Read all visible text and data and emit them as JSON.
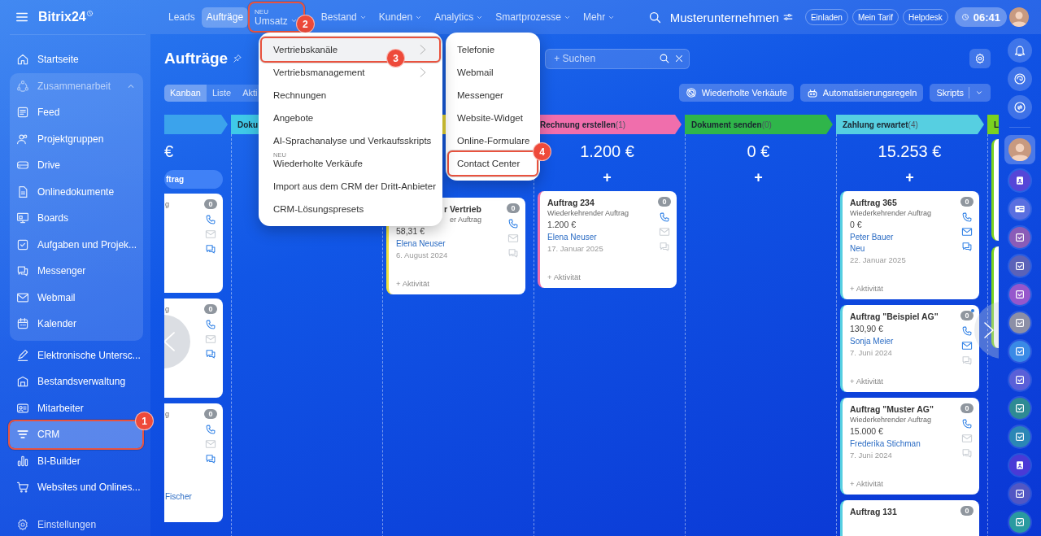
{
  "logo": "Bitrix24",
  "nav": [
    {
      "label": "Leads",
      "selected": false,
      "dropdown": false
    },
    {
      "label": "Aufträge",
      "selected": true,
      "dropdown": false
    },
    {
      "label": "Umsatz",
      "selected": false,
      "dropdown": true,
      "tag": "NEU",
      "callout": {
        "number": "2"
      }
    },
    {
      "label": "Bestand",
      "selected": false,
      "dropdown": true
    },
    {
      "label": "Kunden",
      "selected": false,
      "dropdown": true
    },
    {
      "label": "Analytics",
      "selected": false,
      "dropdown": true
    },
    {
      "label": "Smartprozesse",
      "selected": false,
      "dropdown": true
    },
    {
      "label": "Mehr",
      "selected": false,
      "dropdown": true
    }
  ],
  "company": "Musterunternehmen",
  "header_buttons": [
    "Einladen",
    "Mein Tarif",
    "Helpdesk"
  ],
  "time": "06:41",
  "sidebar": {
    "items": [
      {
        "kind": "item",
        "label": "Startseite",
        "selected": false
      },
      {
        "kind": "group",
        "label": "Zusammenarbeit",
        "expanded": true,
        "children": [
          {
            "label": "Feed",
            "selected": false
          },
          {
            "label": "Projektgruppen",
            "selected": false
          },
          {
            "label": "Drive",
            "selected": false
          },
          {
            "label": "Onlinedokumente",
            "selected": false
          },
          {
            "label": "Boards",
            "selected": false
          },
          {
            "label": "Aufgaben und Projek...",
            "selected": false
          },
          {
            "label": "Messenger",
            "selected": false
          },
          {
            "label": "Webmail",
            "selected": false
          },
          {
            "label": "Kalender",
            "selected": false
          }
        ]
      },
      {
        "kind": "item",
        "label": "Elektronische Untersc...",
        "selected": false
      },
      {
        "kind": "item",
        "label": "Bestandsverwaltung",
        "selected": false
      },
      {
        "kind": "item",
        "label": "Mitarbeiter",
        "selected": false
      },
      {
        "kind": "item",
        "label": "CRM",
        "selected": true,
        "callout": {
          "number": "1"
        }
      },
      {
        "kind": "item",
        "label": "BI-Builder",
        "selected": false
      },
      {
        "kind": "item",
        "label": "Websites und Onlines...",
        "selected": false
      }
    ],
    "footer": "Einstellungen"
  },
  "page": {
    "title": "Aufträge",
    "search": {
      "placeholder": "+ Suchen"
    },
    "views": [
      {
        "label": "Kanban",
        "selected": true
      },
      {
        "label": "Liste",
        "selected": false
      },
      {
        "label": "Akti",
        "selected": false
      }
    ],
    "actions": [
      {
        "label": "Wiederholte Verkäufe",
        "kind": "icon"
      },
      {
        "label": "Automatisierungsregeln",
        "kind": "icon"
      },
      {
        "label": "Skripts",
        "kind": "split"
      }
    ]
  },
  "board": {
    "columns": [
      {
        "kind": "cut",
        "color": "#3ba3ec",
        "amount": "€",
        "button": "ftrag",
        "cards": [
          {
            "subtitle": "g",
            "counter": "0",
            "phone": true,
            "mail": false,
            "chat": true
          },
          {
            "subtitle": "g",
            "counter": "0",
            "phone": true,
            "mail": false,
            "chat": true
          },
          {
            "subtitle": "g",
            "person": "Fischer",
            "counter": "0",
            "phone": true,
            "mail": false,
            "chat": true
          }
        ]
      },
      {
        "kind": "full",
        "title": "Doku",
        "color": "#3fc9e8"
      },
      {
        "kind": "covered",
        "color": "#f2e23a",
        "cards": [
          {
            "title": "r Vertrieb",
            "subtitle": "er Auftrag",
            "amount": "58,31 €",
            "person": "Elena Neuser",
            "date": "6. August 2024",
            "activity": "+ Aktivität",
            "counter": "0",
            "phone": true,
            "mail": false,
            "chat": false
          }
        ]
      },
      {
        "kind": "full",
        "title": "Rechnung erstellen",
        "count": "(1)",
        "color": "#f06eac",
        "amount": "1.200 €",
        "add": "+",
        "cards": [
          {
            "title": "Auftrag 234",
            "subtitle": "Wiederkehrender Auftrag",
            "amount": "1.200 €",
            "person": "Elena Neuser",
            "date": "17. Januar 2025",
            "activity": "+ Aktivität",
            "counter": "0",
            "phone": true,
            "mail": false,
            "chat": false
          }
        ]
      },
      {
        "kind": "full",
        "title": "Dokument senden",
        "count": "(0)",
        "color": "#2fb54a",
        "amount": "0 €",
        "add": "+"
      },
      {
        "kind": "full",
        "title": "Zahlung erwartet",
        "count": "(4)",
        "color": "#56cfe1",
        "amount": "15.253 €",
        "add": "+",
        "cards": [
          {
            "title": "Auftrag 365",
            "subtitle": "Wiederkehrender Auftrag",
            "amount": "0 €",
            "person": "Peter Bauer",
            "status": "Neu",
            "date": "22. Januar 2025",
            "activity": "+ Aktivität",
            "counter": "0",
            "phone": true,
            "mail": true,
            "chat": true
          },
          {
            "title": "Auftrag \"Beispiel AG\"",
            "amount": "130,90 €",
            "person": "Sonja Meier",
            "date": "7. Juni 2024",
            "activity": "+ Aktivität",
            "counter": "0",
            "unread": true,
            "phone": true,
            "mail": true,
            "chat": false
          },
          {
            "title": "Auftrag \"Muster AG\"",
            "subtitle": "Wiederkehrender Auftrag",
            "amount": "15.000 €",
            "person": "Frederika Stichman",
            "date": "7. Juni 2024",
            "activity": "+ Aktivität",
            "counter": "0",
            "phone": true,
            "mail": false,
            "chat": false
          },
          {
            "title": "Auftrag 131",
            "counter": "0",
            "kind": "last"
          }
        ]
      },
      {
        "kind": "full",
        "title": "L",
        "color": "#7bd21f",
        "cards": [
          {
            "kind": "hidden"
          },
          {
            "kind": "hidden"
          }
        ]
      }
    ]
  },
  "menu": {
    "items": [
      {
        "label": "Vertriebskanäle",
        "selected": true,
        "submenu": true,
        "callout": {
          "number": "3"
        }
      },
      {
        "label": "Vertriebsmanagement",
        "selected": false,
        "submenu": true
      },
      {
        "label": "Rechnungen",
        "selected": false,
        "submenu": false
      },
      {
        "label": "Angebote",
        "selected": false,
        "submenu": false
      },
      {
        "label": "AI-Sprachanalyse und Verkaufsskripts",
        "selected": false,
        "submenu": false
      },
      {
        "label": "Wiederholte Verkäufe",
        "selected": false,
        "submenu": false,
        "tag": "NEU"
      },
      {
        "label": "Import aus dem CRM der Dritt-Anbieter",
        "selected": false,
        "submenu": false
      },
      {
        "label": "CRM-Lösungspresets",
        "selected": false,
        "submenu": false
      }
    ]
  },
  "submenu": {
    "items": [
      {
        "label": "Telefonie"
      },
      {
        "label": "Webmail"
      },
      {
        "label": "Messenger"
      },
      {
        "label": "Website-Widget"
      },
      {
        "label": "Online-Formulare"
      },
      {
        "label": "Contact Center",
        "callout": {
          "number": "4"
        }
      }
    ]
  },
  "rightbar": {
    "apps": [
      {
        "kind": "contact",
        "color": "#5546d8"
      },
      {
        "kind": "card",
        "color": "#5a6fe0"
      },
      {
        "kind": "check",
        "color": "#8a5cb8"
      },
      {
        "kind": "check",
        "color": "#5b62b8"
      },
      {
        "kind": "check",
        "color": "#9657cc"
      },
      {
        "kind": "check",
        "color": "#8c8fa6"
      },
      {
        "kind": "check",
        "color": "#3a8ae6"
      },
      {
        "kind": "check",
        "color": "#5a60d8"
      },
      {
        "kind": "check",
        "color": "#2e8a94"
      },
      {
        "kind": "check",
        "color": "#2b86b6"
      },
      {
        "kind": "contact",
        "color": "#4a3ad6"
      },
      {
        "kind": "check",
        "color": "#5157c4"
      },
      {
        "kind": "check",
        "color": "#2a9aa0"
      }
    ]
  }
}
